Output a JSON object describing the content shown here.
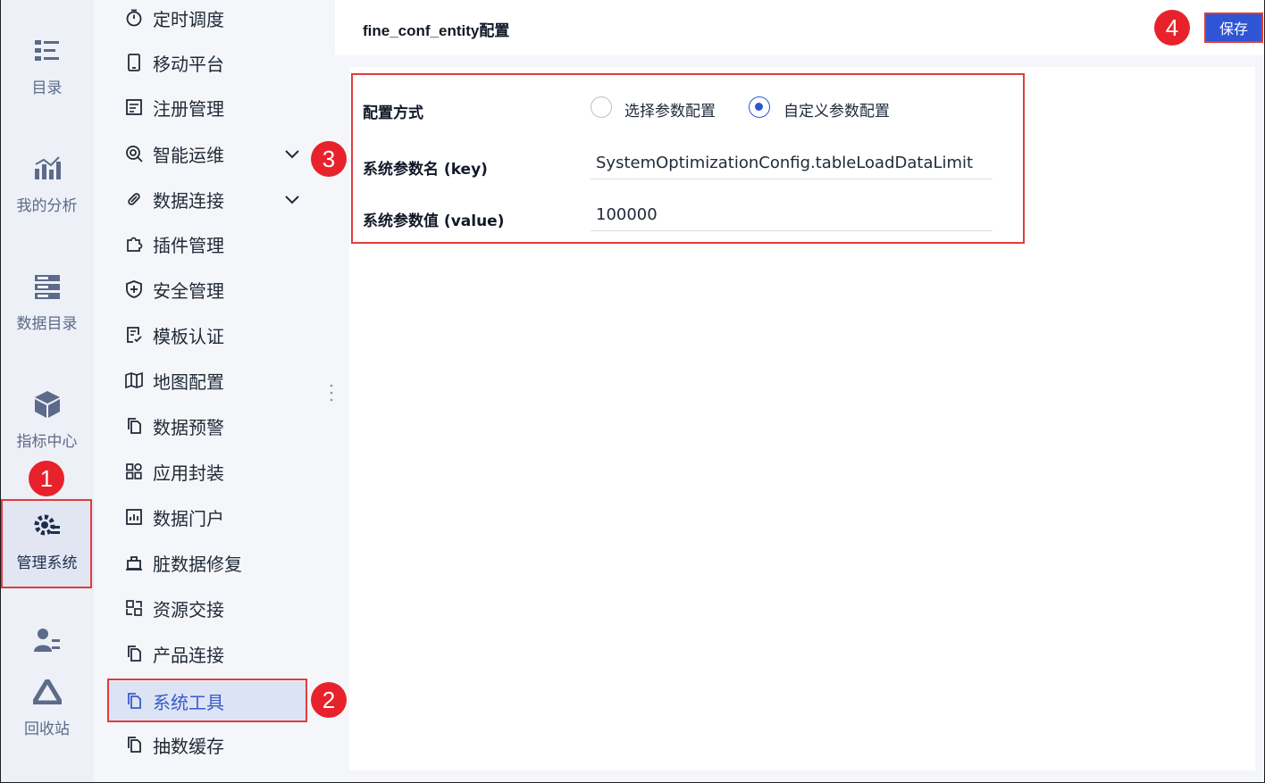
{
  "rail": {
    "items": [
      {
        "label": "目录",
        "icon": "catalog-icon"
      },
      {
        "label": "我的分析",
        "icon": "analysis-chart-icon"
      },
      {
        "label": "数据目录",
        "icon": "data-catalog-icon"
      },
      {
        "label": "指标中心",
        "icon": "cube-icon"
      },
      {
        "label": "管理系统",
        "icon": "gear-manage-icon",
        "active": true
      },
      {
        "label": "",
        "icon": "user-list-icon"
      },
      {
        "label": "回收站",
        "icon": "recycle-icon"
      }
    ]
  },
  "menu": {
    "items": [
      {
        "label": "定时调度",
        "icon": "timer-icon"
      },
      {
        "label": "移动平台",
        "icon": "mobile-icon"
      },
      {
        "label": "注册管理",
        "icon": "register-icon"
      },
      {
        "label": "智能运维",
        "icon": "ops-icon",
        "expandable": true
      },
      {
        "label": "数据连接",
        "icon": "link-icon",
        "expandable": true
      },
      {
        "label": "插件管理",
        "icon": "puzzle-icon"
      },
      {
        "label": "安全管理",
        "icon": "shield-icon"
      },
      {
        "label": "模板认证",
        "icon": "template-cert-icon"
      },
      {
        "label": "地图配置",
        "icon": "map-icon"
      },
      {
        "label": "数据预警",
        "icon": "copy-icon"
      },
      {
        "label": "应用封装",
        "icon": "apps-grid-icon"
      },
      {
        "label": "数据门户",
        "icon": "portal-icon"
      },
      {
        "label": "脏数据修复",
        "icon": "repair-icon"
      },
      {
        "label": "资源交接",
        "icon": "handover-icon"
      },
      {
        "label": "产品连接",
        "icon": "copy-icon"
      },
      {
        "label": "系统工具",
        "icon": "copy-icon",
        "active": true
      },
      {
        "label": "抽数缓存",
        "icon": "copy-icon"
      }
    ]
  },
  "header": {
    "title": "fine_conf_entity配置",
    "save_label": "保存"
  },
  "form": {
    "mode_label": "配置方式",
    "option_select": "选择参数配置",
    "option_custom": "自定义参数配置",
    "selected_option": "自定义参数配置",
    "key_label": "系统参数名 (key)",
    "key_value": "SystemOptimizationConfig.tableLoadDataLimit",
    "value_label": "系统参数值 (value)",
    "value_value": "100000"
  },
  "callouts": [
    "1",
    "2",
    "3",
    "4"
  ],
  "colors": {
    "accent": "#2f55d4",
    "highlight": "#e03c3c",
    "badge": "#e8222b",
    "rail_bg": "#eef0f7"
  }
}
